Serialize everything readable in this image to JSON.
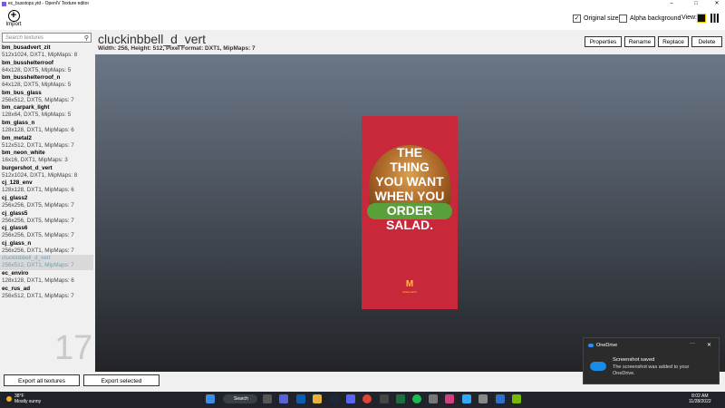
{
  "window": {
    "title": "ec_busstops.ytd - OpenIV Texture editor",
    "min": "–",
    "max": "□",
    "close": "✕"
  },
  "toolbar": {
    "import_label": "Import",
    "import_glyph": "+",
    "original_size": "Original size",
    "original_size_check": "✓",
    "alpha_background": "Alpha background",
    "view_label": "View:"
  },
  "search": {
    "placeholder": "Search textures",
    "icon": "⚲"
  },
  "textures": [
    {
      "name": "bm_busadvert_zit",
      "info": "512x1024, DXT1, MipMaps: 8"
    },
    {
      "name": "bm_busshelterroof",
      "info": "64x128, DXT5, MipMaps: 5"
    },
    {
      "name": "bm_busshelterroof_n",
      "info": "64x128, DXT5, MipMaps: 5"
    },
    {
      "name": "bm_bus_glass",
      "info": "256x512, DXT5, MipMaps: 7"
    },
    {
      "name": "bm_carpark_light",
      "info": "128x64, DXT5, MipMaps: 5"
    },
    {
      "name": "bm_glass_n",
      "info": "128x128, DXT1, MipMaps: 6"
    },
    {
      "name": "bm_metal2",
      "info": "512x512, DXT1, MipMaps: 7"
    },
    {
      "name": "bm_neon_white",
      "info": "16x16, DXT1, MipMaps: 3"
    },
    {
      "name": "burgershot_d_vert",
      "info": "512x1024, DXT1, MipMaps: 8"
    },
    {
      "name": "cj_128_env",
      "info": "128x128, DXT1, MipMaps: 6"
    },
    {
      "name": "cj_glass2",
      "info": "256x256, DXT5, MipMaps: 7"
    },
    {
      "name": "cj_glass5",
      "info": "256x256, DXT5, MipMaps: 7"
    },
    {
      "name": "cj_glass6",
      "info": "256x256, DXT5, MipMaps: 7"
    },
    {
      "name": "cj_glass_n",
      "info": "256x256, DXT1, MipMaps: 7"
    },
    {
      "name": "cluckinbbell_d_vert",
      "info": "256x512, DXT1, MipMaps: 7"
    },
    {
      "name": "ec_enviro",
      "info": "128x128, DXT1, MipMaps: 6"
    },
    {
      "name": "ec_rus_ad",
      "info": "256x512, DXT1, MipMaps: 7"
    }
  ],
  "texture_count": "17",
  "selected": {
    "name": "cluckinbbell_d_vert",
    "info": "Width: 256, Height: 512, Pixel Format: DXT1, MipMaps: 7"
  },
  "actions": {
    "properties": "Properties",
    "rename": "Rename",
    "replace": "Replace",
    "delete": "Delete"
  },
  "poster": {
    "line1": "THE",
    "line2": "THING",
    "line3": "YOU WANT",
    "line4": "WHEN YOU",
    "line5": "ORDER",
    "line6": "SALAD.",
    "logo": "M",
    "brand": "McDonald's"
  },
  "bottom": {
    "export_all": "Export all textures",
    "export_selected": "Export selected"
  },
  "taskbar": {
    "temp": "38°F",
    "weather": "Mostly sunny",
    "search": "Search",
    "time": "8:02 AM",
    "date": "11/28/2022"
  },
  "toast": {
    "app": "OneDrive",
    "more": "···",
    "close": "✕",
    "title": "Screenshot saved",
    "body": "The screenshot was added to your OneDrive."
  }
}
